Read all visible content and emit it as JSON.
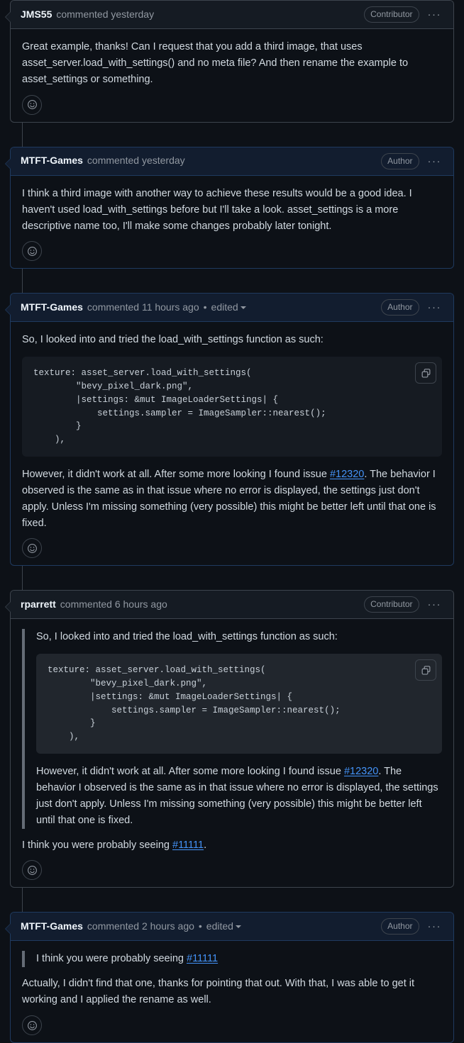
{
  "thread": {
    "comments": [
      {
        "author": "JMS55",
        "meta": "commented yesterday",
        "badge": "Contributor",
        "is_author": false,
        "edited": null,
        "blocks": [
          {
            "type": "paragraph",
            "text": "Great example, thanks! Can I request that you add a third image, that uses asset_server.load_with_settings() and no meta file? And then rename the example to asset_settings or something."
          }
        ]
      },
      {
        "author": "MTFT-Games",
        "meta": "commented yesterday",
        "badge": "Author",
        "is_author": true,
        "edited": null,
        "blocks": [
          {
            "type": "paragraph",
            "text": "I think a third image with another way to achieve these results would be a good idea. I haven't used load_with_settings before but I'll take a look. asset_settings is a more descriptive name too, I'll make some changes probably later tonight."
          }
        ]
      },
      {
        "author": "MTFT-Games",
        "meta": "commented 11 hours ago",
        "badge": "Author",
        "is_author": true,
        "edited": "edited",
        "blocks": [
          {
            "type": "paragraph",
            "text": "So, I looked into and tried the load_with_settings function as such:"
          },
          {
            "type": "code",
            "code": "texture: asset_server.load_with_settings(\n        \"bevy_pixel_dark.png\",\n        |settings: &mut ImageLoaderSettings| {\n            settings.sampler = ImageSampler::nearest();\n        }\n    ),"
          },
          {
            "type": "paragraph_link",
            "text_before": "However, it didn't work at all. After some more looking I found issue ",
            "link": "#12320",
            "text_after": ". The behavior I observed is the same as in that issue where no error is displayed, the settings just don't apply. Unless I'm missing something (very possible) this might be better left until that one is fixed."
          }
        ]
      },
      {
        "author": "rparrett",
        "meta": "commented 6 hours ago",
        "badge": "Contributor",
        "is_author": false,
        "edited": null,
        "blocks": [
          {
            "type": "quote",
            "quote_blocks": [
              {
                "type": "paragraph",
                "text": "So, I looked into and tried the load_with_settings function as such:"
              },
              {
                "type": "code",
                "code": "texture: asset_server.load_with_settings(\n        \"bevy_pixel_dark.png\",\n        |settings: &mut ImageLoaderSettings| {\n            settings.sampler = ImageSampler::nearest();\n        }\n    ),"
              },
              {
                "type": "paragraph_link",
                "text_before": "However, it didn't work at all. After some more looking I found issue ",
                "link": "#12320",
                "text_after": ". The behavior I observed is the same as in that issue where no error is displayed, the settings just don't apply. Unless I'm missing something (very possible) this might be better left until that one is fixed."
              }
            ]
          },
          {
            "type": "paragraph_link",
            "text_before": "I think you were probably seeing ",
            "link": "#11111",
            "text_after": "."
          }
        ]
      },
      {
        "author": "MTFT-Games",
        "meta": "commented 2 hours ago",
        "badge": "Author",
        "is_author": true,
        "edited": "edited",
        "blocks": [
          {
            "type": "quote",
            "quote_blocks": [
              {
                "type": "paragraph_link",
                "text_before": "I think you were probably seeing ",
                "link": "#11111",
                "text_after": ""
              }
            ]
          },
          {
            "type": "paragraph",
            "text": "Actually, I didn't find that one, thanks for pointing that out. With that, I was able to get it working and I applied the rename as well."
          }
        ]
      }
    ]
  },
  "icons": {
    "kebab": "···",
    "copy": "copy-icon",
    "reaction": "smiley-icon",
    "caret": "chevron-down-icon"
  },
  "colors": {
    "link": "#4493f8",
    "page_bg": "#0d1117",
    "header_bg": "#151b23",
    "header_bg_author": "#121d2f",
    "border": "#3d444d",
    "border_author": "#1f3a5f",
    "muted": "#9198a1",
    "code_bg": "#161b22"
  }
}
